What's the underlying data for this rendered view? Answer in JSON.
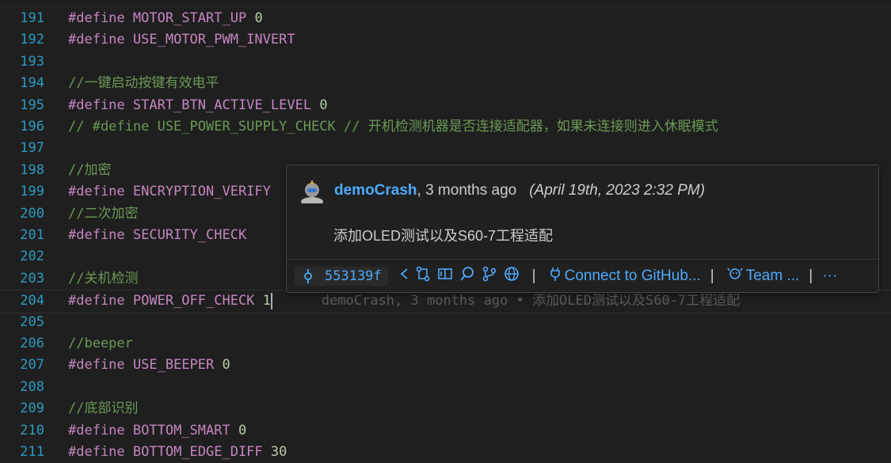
{
  "lines": [
    {
      "n": "191",
      "tokens": [
        {
          "t": "#define ",
          "c": "kw"
        },
        {
          "t": "MOTOR_START_UP",
          "c": "mac"
        },
        {
          "t": " ",
          "c": ""
        },
        {
          "t": "0",
          "c": "num"
        }
      ]
    },
    {
      "n": "192",
      "tokens": [
        {
          "t": "#define ",
          "c": "kw"
        },
        {
          "t": "USE_MOTOR_PWM_INVERT",
          "c": "mac"
        }
      ]
    },
    {
      "n": "193",
      "tokens": []
    },
    {
      "n": "194",
      "tokens": [
        {
          "t": "//一键启动按键有效电平",
          "c": "cm"
        }
      ]
    },
    {
      "n": "195",
      "tokens": [
        {
          "t": "#define ",
          "c": "kw"
        },
        {
          "t": "START_BTN_ACTIVE_LEVEL",
          "c": "mac"
        },
        {
          "t": " ",
          "c": ""
        },
        {
          "t": "0",
          "c": "num"
        }
      ]
    },
    {
      "n": "196",
      "tokens": [
        {
          "t": "// #define USE_POWER_SUPPLY_CHECK // 开机检测机器是否连接适配器，如果未连接则进入休眠模式",
          "c": "cm"
        }
      ]
    },
    {
      "n": "197",
      "tokens": []
    },
    {
      "n": "198",
      "tokens": [
        {
          "t": "//加密",
          "c": "cm"
        }
      ]
    },
    {
      "n": "199",
      "tokens": [
        {
          "t": "#define ",
          "c": "kw"
        },
        {
          "t": "ENCRYPTION_VERIFY",
          "c": "mac"
        }
      ]
    },
    {
      "n": "200",
      "tokens": [
        {
          "t": "//二次加密",
          "c": "cm"
        }
      ]
    },
    {
      "n": "201",
      "tokens": [
        {
          "t": "#define ",
          "c": "kw"
        },
        {
          "t": "SECURITY_CHECK",
          "c": "mac"
        }
      ]
    },
    {
      "n": "202",
      "tokens": []
    },
    {
      "n": "203",
      "tokens": [
        {
          "t": "//关机检测",
          "c": "cm"
        }
      ]
    },
    {
      "n": "204",
      "tokens": [
        {
          "t": "#define ",
          "c": "kw"
        },
        {
          "t": "POWER_OFF_CHECK",
          "c": "mac"
        },
        {
          "t": " ",
          "c": ""
        },
        {
          "t": "1",
          "c": "num"
        }
      ],
      "current": true
    },
    {
      "n": "205",
      "tokens": []
    },
    {
      "n": "206",
      "tokens": [
        {
          "t": "//beeper",
          "c": "cm"
        }
      ]
    },
    {
      "n": "207",
      "tokens": [
        {
          "t": "#define ",
          "c": "kw"
        },
        {
          "t": "USE_BEEPER",
          "c": "mac"
        },
        {
          "t": " ",
          "c": ""
        },
        {
          "t": "0",
          "c": "num"
        }
      ]
    },
    {
      "n": "208",
      "tokens": []
    },
    {
      "n": "209",
      "tokens": [
        {
          "t": "//底部识别",
          "c": "cm"
        }
      ]
    },
    {
      "n": "210",
      "tokens": [
        {
          "t": "#define ",
          "c": "kw"
        },
        {
          "t": "BOTTOM_SMART",
          "c": "mac"
        },
        {
          "t": " ",
          "c": ""
        },
        {
          "t": "0",
          "c": "num"
        }
      ]
    },
    {
      "n": "211",
      "tokens": [
        {
          "t": "#define ",
          "c": "kw"
        },
        {
          "t": "BOTTOM_EDGE_DIFF",
          "c": "mac"
        },
        {
          "t": " ",
          "c": ""
        },
        {
          "t": "30",
          "c": "num"
        }
      ]
    }
  ],
  "inline_blame": "demoCrash, 3 months ago • 添加OLED测试以及S60-7工程适配",
  "hover": {
    "author": "demoCrash",
    "ago": ", 3 months ago",
    "date": "(April 19th, 2023 2:32 PM)",
    "message": "添加OLED测试以及S60-7工程适配",
    "sha": "553139f",
    "connect_label": "Connect to GitHub...",
    "team_label": "Team ...",
    "more_label": "···"
  },
  "colors": {
    "keyword": "#c586c0",
    "number": "#b5cea8",
    "comment": "#6a9955",
    "link": "#4daafc",
    "line_number": "#2a9bc1"
  }
}
